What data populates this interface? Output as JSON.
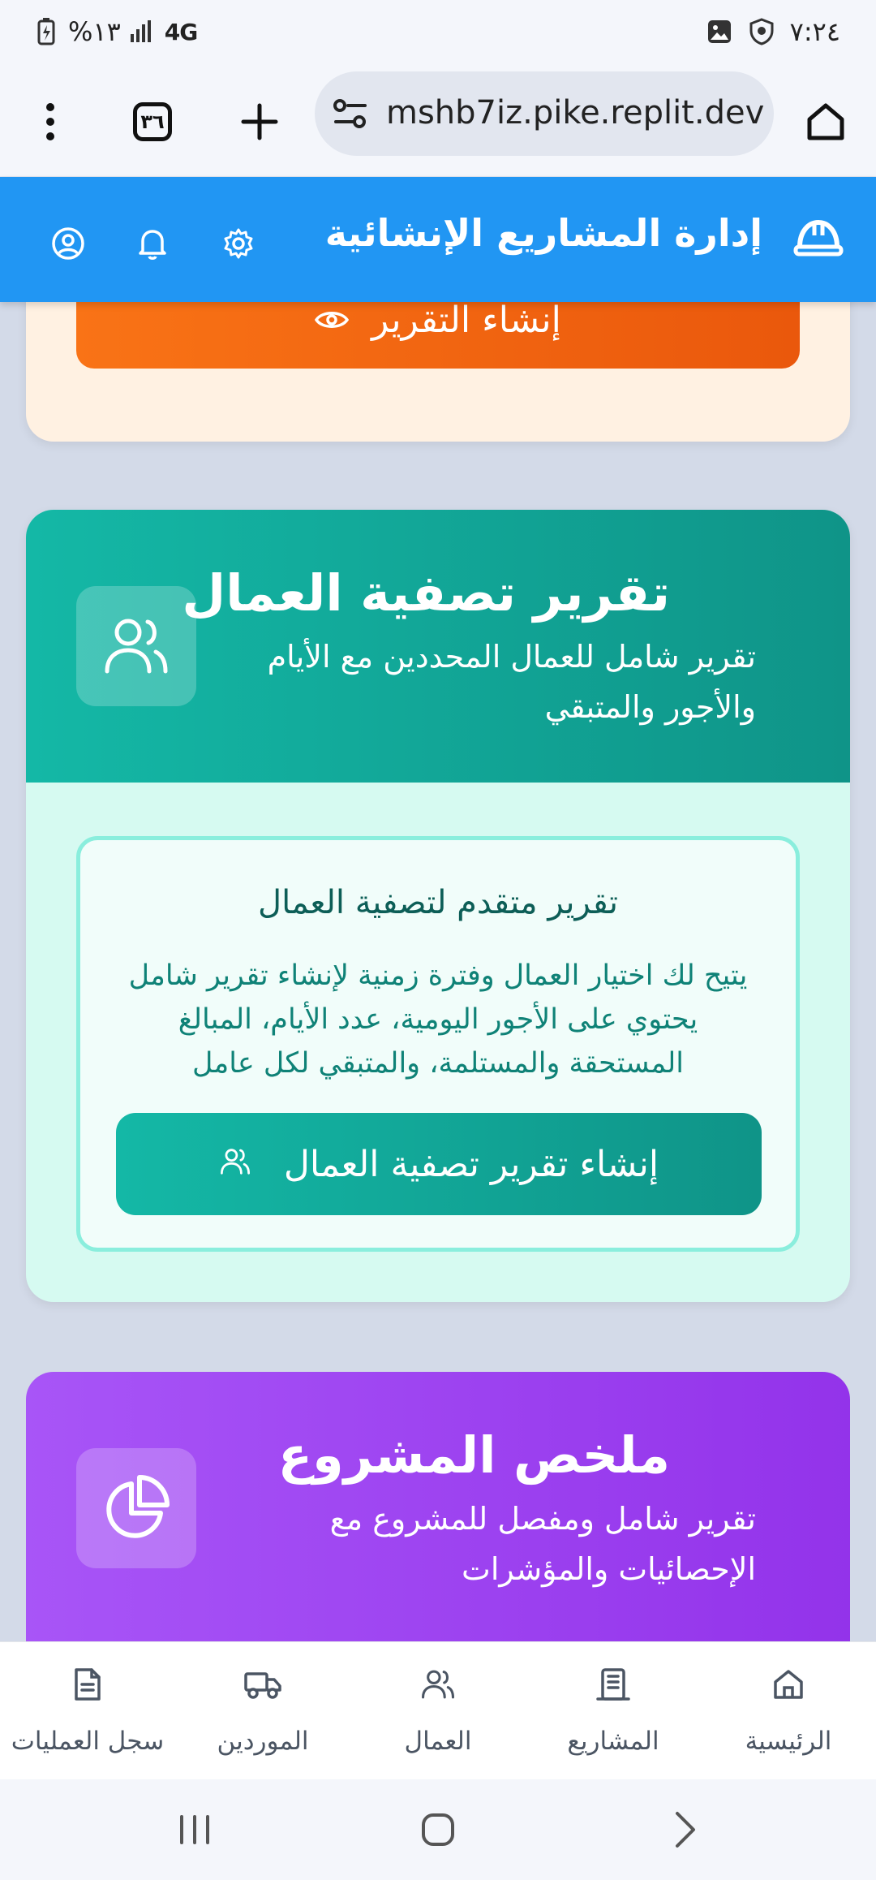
{
  "status_bar": {
    "battery": "%١٣",
    "network": "4G",
    "time": "٧:٢٤"
  },
  "browser": {
    "tab_count": "٣٦",
    "url": "mshb7iz.pike.replit.dev",
    "icons": [
      "menu-dots-icon",
      "tabs-icon",
      "plus-icon",
      "site-settings-icon",
      "home-icon"
    ]
  },
  "header": {
    "title": "إدارة المشاريع الإنشائية",
    "color": "#2196f3",
    "icons": [
      "helmet-icon",
      "gear-icon",
      "bell-icon",
      "user-icon"
    ]
  },
  "card_report": {
    "button_label": "إنشاء التقرير",
    "color": "#f97316"
  },
  "card_workers": {
    "title": "تقرير تصفية العمال",
    "subtitle": "تقرير شامل للعمال المحددين مع الأيام والأجور والمتبقي",
    "inner_title": "تقرير متقدم لتصفية العمال",
    "inner_description": "يتيح لك اختيار العمال وفترة زمنية لإنشاء تقرير شامل يحتوي على الأجور اليومية، عدد الأيام، المبالغ المستحقة والمستلمة، والمتبقي لكل عامل",
    "button_label": "إنشاء تقرير تصفية العمال",
    "color": "#14b8a6"
  },
  "card_summary": {
    "title": "ملخص المشروع",
    "subtitle": "تقرير شامل ومفصل للمشروع مع الإحصائيات والمؤشرات",
    "color": "#a855f7"
  },
  "bottom_nav": [
    {
      "label": "الرئيسية",
      "icon": "home-icon"
    },
    {
      "label": "المشاريع",
      "icon": "building-icon"
    },
    {
      "label": "العمال",
      "icon": "users-icon"
    },
    {
      "label": "الموردين",
      "icon": "truck-icon"
    },
    {
      "label": "سجل العمليات",
      "icon": "document-icon"
    }
  ]
}
